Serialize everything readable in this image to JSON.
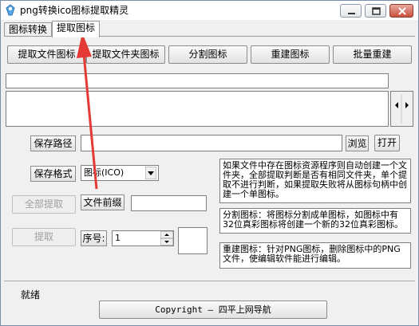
{
  "window": {
    "title": "png转换ico图标提取精灵",
    "accent": "#e53935"
  },
  "tabs": [
    {
      "label": "图标转换",
      "active": false
    },
    {
      "label": "提取图标",
      "active": true
    }
  ],
  "toolbar": {
    "extract_file_icon": "提取文件图标",
    "extract_folder_icon": "提取文件夹图标",
    "split_icon": "分割图标",
    "rebuild_icon": "重建图标",
    "batch_rebuild": "批量重建"
  },
  "form": {
    "save_path_label": "保存路径",
    "save_path_value": "",
    "browse_label": "浏览",
    "open_label": "打开",
    "save_format_label": "保存格式",
    "save_format_value": "图标(ICO)",
    "extract_all_label": "全部提取",
    "file_prefix_label": "文件前缀",
    "file_prefix_value": "",
    "extract_label": "提取",
    "index_label": "序号:",
    "index_value": "1"
  },
  "info": {
    "extract": "如果文件中存在图标资源程序则自动创建一个文件夹，全部提取判断是否有相同文件夹，单个提取不进行判断，如果提取失败将从图标句柄中创建一个单图标。",
    "split": "分割图标：将图标分割成单图标，如图标中有32位真彩图标将创建一个新的32位真彩图标。",
    "rebuild": "重建图标：针对PNG图标，删除图标中的PNG文件，使编辑软件能进行编辑。"
  },
  "status": {
    "text": "就绪",
    "copyright": "Copyright — 四平上网导航"
  }
}
